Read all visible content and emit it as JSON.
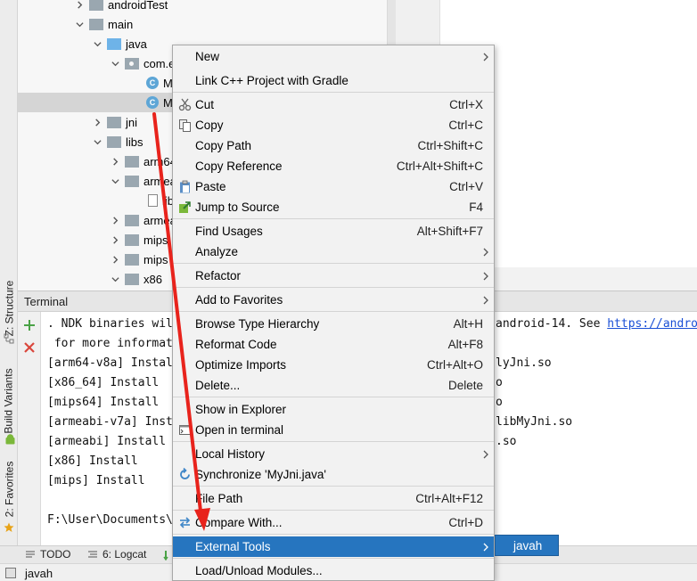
{
  "tree": {
    "rows": [
      {
        "label": "androidTest"
      },
      {
        "label": "main"
      },
      {
        "label": "java"
      },
      {
        "label": "com.e"
      },
      {
        "label": "M"
      },
      {
        "label": "My"
      },
      {
        "label": "jni"
      },
      {
        "label": "libs"
      },
      {
        "label": "arm64"
      },
      {
        "label": "armea"
      },
      {
        "label": "lib"
      },
      {
        "label": "armea"
      },
      {
        "label": "mips"
      },
      {
        "label": "mips"
      },
      {
        "label": "x86"
      }
    ]
  },
  "side_tabs": {
    "structure": "Z: Structure",
    "build_variants": "Build Variants",
    "favorites": "2: Favorites"
  },
  "terminal": {
    "title": "Terminal",
    "lines": [
      {
        "left": ". NDK binaries wil",
        "right": "android-14. See ",
        "link": "https://andro"
      },
      {
        "left": " for more informat",
        "right": "",
        "link": ""
      },
      {
        "left": "[arm64-v8a] Instal",
        "right": "lyJni.so",
        "link": ""
      },
      {
        "left": "[x86_64] Install",
        "right": "o",
        "link": ""
      },
      {
        "left": "[mips64] Install",
        "right": "o",
        "link": ""
      },
      {
        "left": "[armeabi-v7a] Inst",
        "right": "libMyJni.so",
        "link": ""
      },
      {
        "left": "[armeabi] Install",
        "right": ".so",
        "link": ""
      },
      {
        "left": "[x86] Install",
        "right": "",
        "link": ""
      },
      {
        "left": "[mips] Install",
        "right": "",
        "link": ""
      },
      {
        "left": "",
        "right": "",
        "link": ""
      },
      {
        "left": "F:\\User\\Documents\\",
        "right": "",
        "link": ""
      }
    ]
  },
  "context_menu": {
    "items": [
      {
        "label": "New",
        "shortcut": "",
        "submenu": true,
        "icon": ""
      },
      {
        "label": "Link C++ Project with Gradle",
        "shortcut": "",
        "submenu": false,
        "icon": ""
      },
      {
        "label": "Cut",
        "shortcut": "Ctrl+X",
        "submenu": false,
        "icon": "scissors-icon"
      },
      {
        "label": "Copy",
        "shortcut": "Ctrl+C",
        "submenu": false,
        "icon": "copy-icon"
      },
      {
        "label": "Copy Path",
        "shortcut": "Ctrl+Shift+C",
        "submenu": false,
        "icon": ""
      },
      {
        "label": "Copy Reference",
        "shortcut": "Ctrl+Alt+Shift+C",
        "submenu": false,
        "icon": ""
      },
      {
        "label": "Paste",
        "shortcut": "Ctrl+V",
        "submenu": false,
        "icon": "paste-icon"
      },
      {
        "label": "Jump to Source",
        "shortcut": "F4",
        "submenu": false,
        "icon": "jump-icon"
      },
      {
        "label": "Find Usages",
        "shortcut": "Alt+Shift+F7",
        "submenu": false,
        "icon": ""
      },
      {
        "label": "Analyze",
        "shortcut": "",
        "submenu": true,
        "icon": ""
      },
      {
        "label": "Refactor",
        "shortcut": "",
        "submenu": true,
        "icon": ""
      },
      {
        "label": "Add to Favorites",
        "shortcut": "",
        "submenu": true,
        "icon": ""
      },
      {
        "label": "Browse Type Hierarchy",
        "shortcut": "Alt+H",
        "submenu": false,
        "icon": ""
      },
      {
        "label": "Reformat Code",
        "shortcut": "Alt+F8",
        "submenu": false,
        "icon": ""
      },
      {
        "label": "Optimize Imports",
        "shortcut": "Ctrl+Alt+O",
        "submenu": false,
        "icon": ""
      },
      {
        "label": "Delete...",
        "shortcut": "Delete",
        "submenu": false,
        "icon": ""
      },
      {
        "label": "Show in Explorer",
        "shortcut": "",
        "submenu": false,
        "icon": ""
      },
      {
        "label": "Open in terminal",
        "shortcut": "",
        "submenu": false,
        "icon": "terminal-icon"
      },
      {
        "label": "Local History",
        "shortcut": "",
        "submenu": true,
        "icon": ""
      },
      {
        "label": "Synchronize 'MyJni.java'",
        "shortcut": "",
        "submenu": false,
        "icon": "sync-icon"
      },
      {
        "label": "File Path",
        "shortcut": "Ctrl+Alt+F12",
        "submenu": false,
        "icon": ""
      },
      {
        "label": "Compare With...",
        "shortcut": "Ctrl+D",
        "submenu": false,
        "icon": "compare-icon"
      },
      {
        "label": "External Tools",
        "shortcut": "",
        "submenu": true,
        "icon": ""
      },
      {
        "label": "Load/Unload Modules...",
        "shortcut": "",
        "submenu": false,
        "icon": ""
      }
    ],
    "submenu_item": "javah"
  },
  "bottom_tabs": {
    "todo": "TODO",
    "logcat": "6: Logcat"
  },
  "status_bar": {
    "text": "javah"
  },
  "colors": {
    "highlight": "#2675bf",
    "annotation": "#e8231c"
  }
}
